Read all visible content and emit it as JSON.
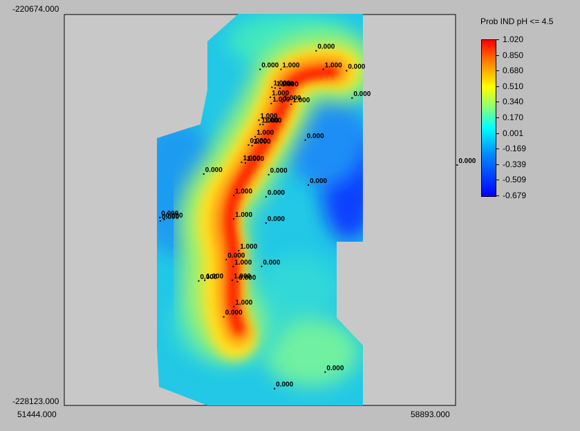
{
  "colors": {
    "background": "#c0bfc0",
    "plot_background": "#c9c8c9"
  },
  "axes": {
    "y_top": "-220674.000",
    "y_bottom": "-228123.000",
    "x_left": "51444.000",
    "x_right": "58893.000"
  },
  "legend": {
    "title": "Prob IND pH <= 4.5",
    "ticks": [
      "1.020",
      "0.850",
      "0.680",
      "0.510",
      "0.340",
      "0.170",
      "0.001",
      "-0.169",
      "-0.339",
      "-0.509",
      "-0.679"
    ]
  },
  "chart_data": {
    "type": "heatmap",
    "title": "",
    "xlim": [
      51444.0,
      58893.0
    ],
    "ylim": [
      -228123.0,
      -220674.0
    ],
    "color_scale": {
      "min": -0.679,
      "max": 1.02,
      "colormap": "jet"
    },
    "points": [
      {
        "x": 56239,
        "y": -221366,
        "label": "0.000"
      },
      {
        "x": 55171,
        "y": -221719,
        "label": "0.000"
      },
      {
        "x": 55569,
        "y": -221719,
        "label": "1.000"
      },
      {
        "x": 56375,
        "y": -221719,
        "label": "1.000"
      },
      {
        "x": 56818,
        "y": -221745,
        "label": "0.000"
      },
      {
        "x": 55398,
        "y": -222061,
        "label": "1.000"
      },
      {
        "x": 55457,
        "y": -222074,
        "label": "1.000"
      },
      {
        "x": 55549,
        "y": -222080,
        "label": "1.000"
      },
      {
        "x": 56923,
        "y": -222264,
        "label": "0.000"
      },
      {
        "x": 55368,
        "y": -222251,
        "label": "1.000"
      },
      {
        "x": 55595,
        "y": -222343,
        "label": "1.000"
      },
      {
        "x": 55384,
        "y": -222370,
        "label": "1.000"
      },
      {
        "x": 55764,
        "y": -222383,
        "label": "1.000"
      },
      {
        "x": 55148,
        "y": -222686,
        "label": "1.000"
      },
      {
        "x": 55171,
        "y": -222771,
        "label": "1.000"
      },
      {
        "x": 55227,
        "y": -222771,
        "label": "1.000"
      },
      {
        "x": 55079,
        "y": -223002,
        "label": "1.000"
      },
      {
        "x": 56032,
        "y": -223068,
        "label": "0.000"
      },
      {
        "x": 54951,
        "y": -223161,
        "label": "0.000"
      },
      {
        "x": 55020,
        "y": -223174,
        "label": "1.000"
      },
      {
        "x": 54820,
        "y": -223489,
        "label": "1.000"
      },
      {
        "x": 54892,
        "y": -223502,
        "label": "1.000"
      },
      {
        "x": 58924,
        "y": -223542,
        "label": "0.000"
      },
      {
        "x": 54099,
        "y": -223713,
        "label": "0.000"
      },
      {
        "x": 55335,
        "y": -223726,
        "label": "0.000"
      },
      {
        "x": 56091,
        "y": -223923,
        "label": "0.000"
      },
      {
        "x": 54669,
        "y": -224121,
        "label": "1.000"
      },
      {
        "x": 55286,
        "y": -224147,
        "label": "0.000"
      },
      {
        "x": 53264,
        "y": -224541,
        "label": "0.000"
      },
      {
        "x": 53346,
        "y": -224581,
        "label": "0.000"
      },
      {
        "x": 53274,
        "y": -224607,
        "label": "0.000"
      },
      {
        "x": 54669,
        "y": -224568,
        "label": "1.000"
      },
      {
        "x": 55286,
        "y": -224647,
        "label": "0.000"
      },
      {
        "x": 54764,
        "y": -225173,
        "label": "1.000"
      },
      {
        "x": 54528,
        "y": -225344,
        "label": "0.000"
      },
      {
        "x": 54659,
        "y": -225475,
        "label": "1.000"
      },
      {
        "x": 55200,
        "y": -225475,
        "label": "0.000"
      },
      {
        "x": 54003,
        "y": -225751,
        "label": "0.000"
      },
      {
        "x": 54118,
        "y": -225738,
        "label": "1.000"
      },
      {
        "x": 54643,
        "y": -225738,
        "label": "1.000"
      },
      {
        "x": 54738,
        "y": -225765,
        "label": "0.000"
      },
      {
        "x": 54673,
        "y": -226238,
        "label": "1.000"
      },
      {
        "x": 54479,
        "y": -226435,
        "label": "0.000"
      },
      {
        "x": 56411,
        "y": -227488,
        "label": "0.000"
      },
      {
        "x": 55447,
        "y": -227803,
        "label": "0.000"
      }
    ]
  }
}
